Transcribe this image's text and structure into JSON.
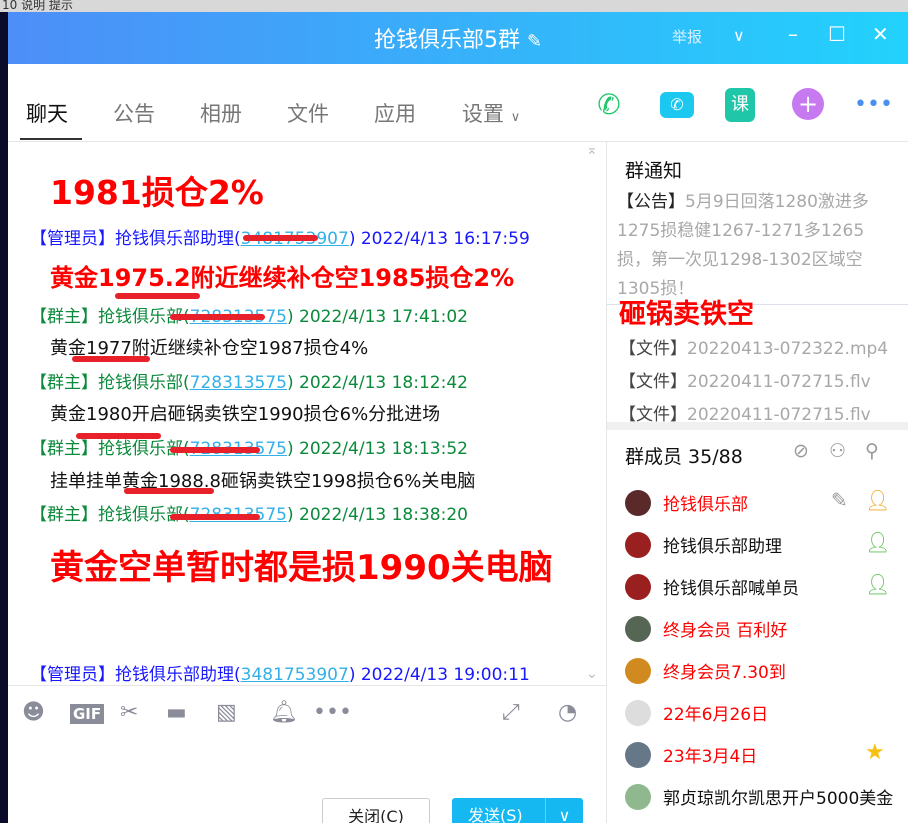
{
  "background_app": {
    "text": "10  说明  提示"
  },
  "window": {
    "title": "抢钱俱乐部5群",
    "report": "举报"
  },
  "tabs": [
    {
      "label": "聊天"
    },
    {
      "label": "公告"
    },
    {
      "label": "相册"
    },
    {
      "label": "文件"
    },
    {
      "label": "应用"
    },
    {
      "label": "设置"
    }
  ],
  "toolbar_icons": [
    "phone-icon",
    "video-call-icon",
    "course-icon",
    "add-app-icon",
    "more-icon"
  ],
  "course_label": "课",
  "chat": {
    "annotation_top": "1981损仓2%",
    "messages": [
      {
        "role": "【管理员】",
        "name": "抢钱俱乐部助理",
        "qq": "3481753907",
        "time": "2022/4/13 16:17:59",
        "text": "黄金1975.2附近继续补仓空1985损仓2%"
      },
      {
        "role": "【群主】",
        "name": "抢钱俱乐部",
        "qq": "728313575",
        "time": "2022/4/13 17:41:02",
        "text": "黄金1977附近继续补仓空1987损仓4%"
      },
      {
        "role": "【群主】",
        "name": "抢钱俱乐部",
        "qq": "728313575",
        "time": "2022/4/13 18:12:42",
        "text": "黄金1980开启砸锅卖铁空1990损仓6%分批进场"
      },
      {
        "role": "【群主】",
        "name": "抢钱俱乐部",
        "qq": "728313575",
        "time": "2022/4/13 18:13:52",
        "text": "挂单挂单黄金1988.8砸锅卖铁空1998损仓6%关电脑"
      },
      {
        "role": "【群主】",
        "name": "抢钱俱乐部",
        "qq": "728313575",
        "time": "2022/4/13 18:38:20",
        "text": "黄金空单暂时都是损1990关电脑"
      },
      {
        "role": "【管理员】",
        "name": "抢钱俱乐部助理",
        "qq": "3481753907",
        "time": "2022/4/13 19:00:11",
        "text": ""
      }
    ]
  },
  "input": {
    "close_label": "关闭(C)",
    "send_label": "发送(S)",
    "gif_label": "GIF"
  },
  "notice": {
    "title": "群通知",
    "tag": "【公告】",
    "text": "5月9日回落1280激进多1275损稳健1267-1271多1265损，第一次见1298-1302区域空1305损！",
    "annotation": "砸锅卖铁空",
    "files": [
      {
        "tag": "【文件】",
        "name": "20220413-072322.mp4"
      },
      {
        "tag": "【文件】",
        "name": "20220411-072715.flv"
      },
      {
        "tag": "【文件】",
        "name": "20220411-072715.flv"
      }
    ]
  },
  "members": {
    "title": "群成员 35/88",
    "list": [
      {
        "name": "抢钱俱乐部",
        "color": "#ff0000"
      },
      {
        "name": "抢钱俱乐部助理",
        "color": "#111111"
      },
      {
        "name": "抢钱俱乐部喊单员",
        "color": "#111111"
      },
      {
        "name": "终身会员 百利好",
        "color": "#ff0000"
      },
      {
        "name": "终身会员7.30到",
        "color": "#ff0000"
      },
      {
        "name": "22年6月26日",
        "color": "#ff0000"
      },
      {
        "name": "23年3月4日",
        "color": "#ff0000"
      },
      {
        "name": "郭贞琼凯尔凯思开户5000美金",
        "color": "#111111"
      }
    ]
  }
}
